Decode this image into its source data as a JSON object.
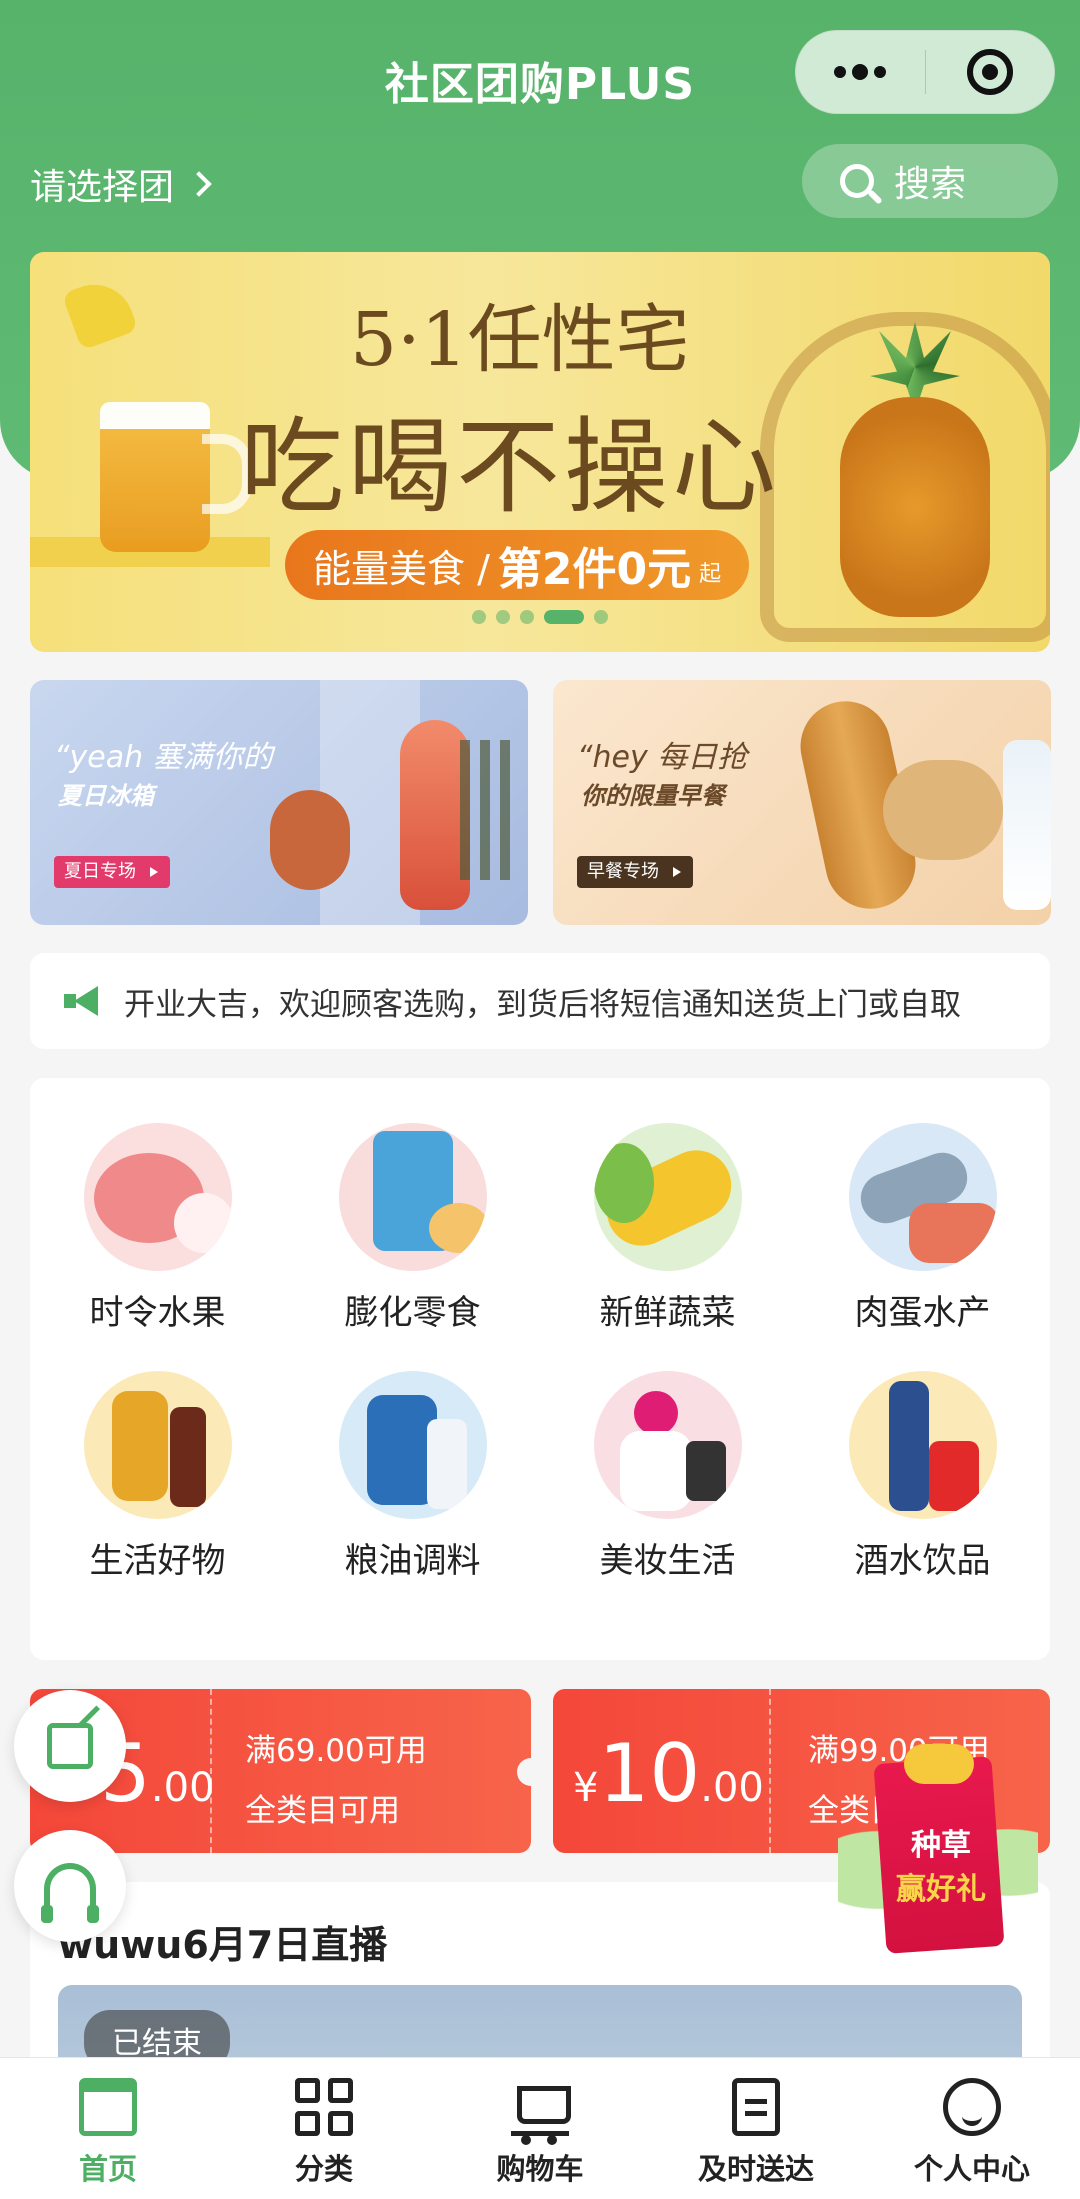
{
  "header": {
    "title": "社区团购PLUS",
    "select_group": "请选择团",
    "search_label": "搜索",
    "accent": "#57b36a"
  },
  "banner": {
    "line1": "5·1任性宅",
    "line2": "吃喝不操心",
    "promo_a": "能量美食 /",
    "promo_b": "第2件0元",
    "promo_c": "起",
    "active_dot": 4,
    "dot_count": 5
  },
  "sub_banners": [
    {
      "line1": "“yeah 塞满你的",
      "line2": "夏日冰箱",
      "tag": "夏日专场"
    },
    {
      "line1": "“hey 每日抢",
      "line2": "你的限量早餐",
      "tag": "早餐专场"
    }
  ],
  "notice": {
    "icon": "megaphone-icon",
    "text": "开业大吉，欢迎顾客选购，到货后将短信通知送货上门或自取"
  },
  "categories": [
    {
      "label": "时令水果"
    },
    {
      "label": "膨化零食"
    },
    {
      "label": "新鲜蔬菜"
    },
    {
      "label": "肉蛋水产"
    },
    {
      "label": "生活好物"
    },
    {
      "label": "粮油调料"
    },
    {
      "label": "美妆生活"
    },
    {
      "label": "酒水饮品"
    }
  ],
  "coupons": [
    {
      "amount_main": "5",
      "amount_dec": ".00",
      "condition": "满69.00可用",
      "scope": "全类目可用"
    },
    {
      "currency": "¥",
      "amount_main": "10",
      "amount_dec": ".00",
      "condition": "满99.00可用",
      "scope": "全类目可用"
    }
  ],
  "gift": {
    "line1": "种草",
    "line2": "赢好礼"
  },
  "live": {
    "title": "wuwu6月7日直播",
    "status": "已结束"
  },
  "tabbar": [
    {
      "label": "首页",
      "icon": "home-icon",
      "active": true
    },
    {
      "label": "分类",
      "icon": "category-icon",
      "active": false
    },
    {
      "label": "购物车",
      "icon": "cart-icon",
      "active": false
    },
    {
      "label": "及时送达",
      "icon": "clipboard-icon",
      "active": false
    },
    {
      "label": "个人中心",
      "icon": "smile-icon",
      "active": false
    }
  ]
}
